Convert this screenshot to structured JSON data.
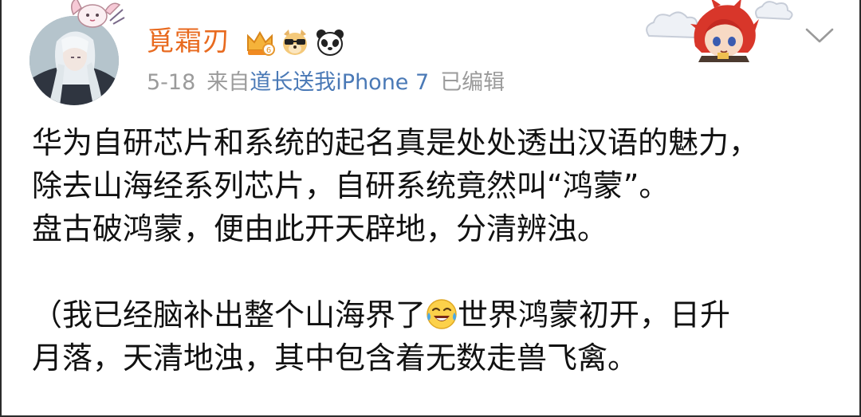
{
  "post": {
    "author": "覓霜刃",
    "date": "5-18",
    "source_prefix": "来自",
    "source": "道长送我iPhone 7",
    "edited": "已编辑",
    "body": {
      "line1": "华为自研芯片和系统的起名真是处处透出汉语的魅力，",
      "line2": "除去山海经系列芯片，自研系统竟然叫“鸿蒙”。",
      "line3": "盘古破鸿蒙，便由此开天辟地，分清辨浊。",
      "line4_before_emoji": "（我已经脑补出整个山海界了",
      "line4_after_emoji": "世界鸿蒙初开，日升",
      "line5": "月落，天清地浊，其中包含着无数走兽飞禽。"
    },
    "emoji_name": "laugh-cry-emoji"
  },
  "icons": {
    "badges": [
      "crown-vip-badge-icon",
      "cool-dog-sunglasses-icon",
      "panda-icon"
    ],
    "menu": "chevron-down-icon"
  },
  "colors": {
    "author": "#e86a1f",
    "meta": "#9b9b9b",
    "source_link": "#4a79b6",
    "body_text": "#111111"
  }
}
